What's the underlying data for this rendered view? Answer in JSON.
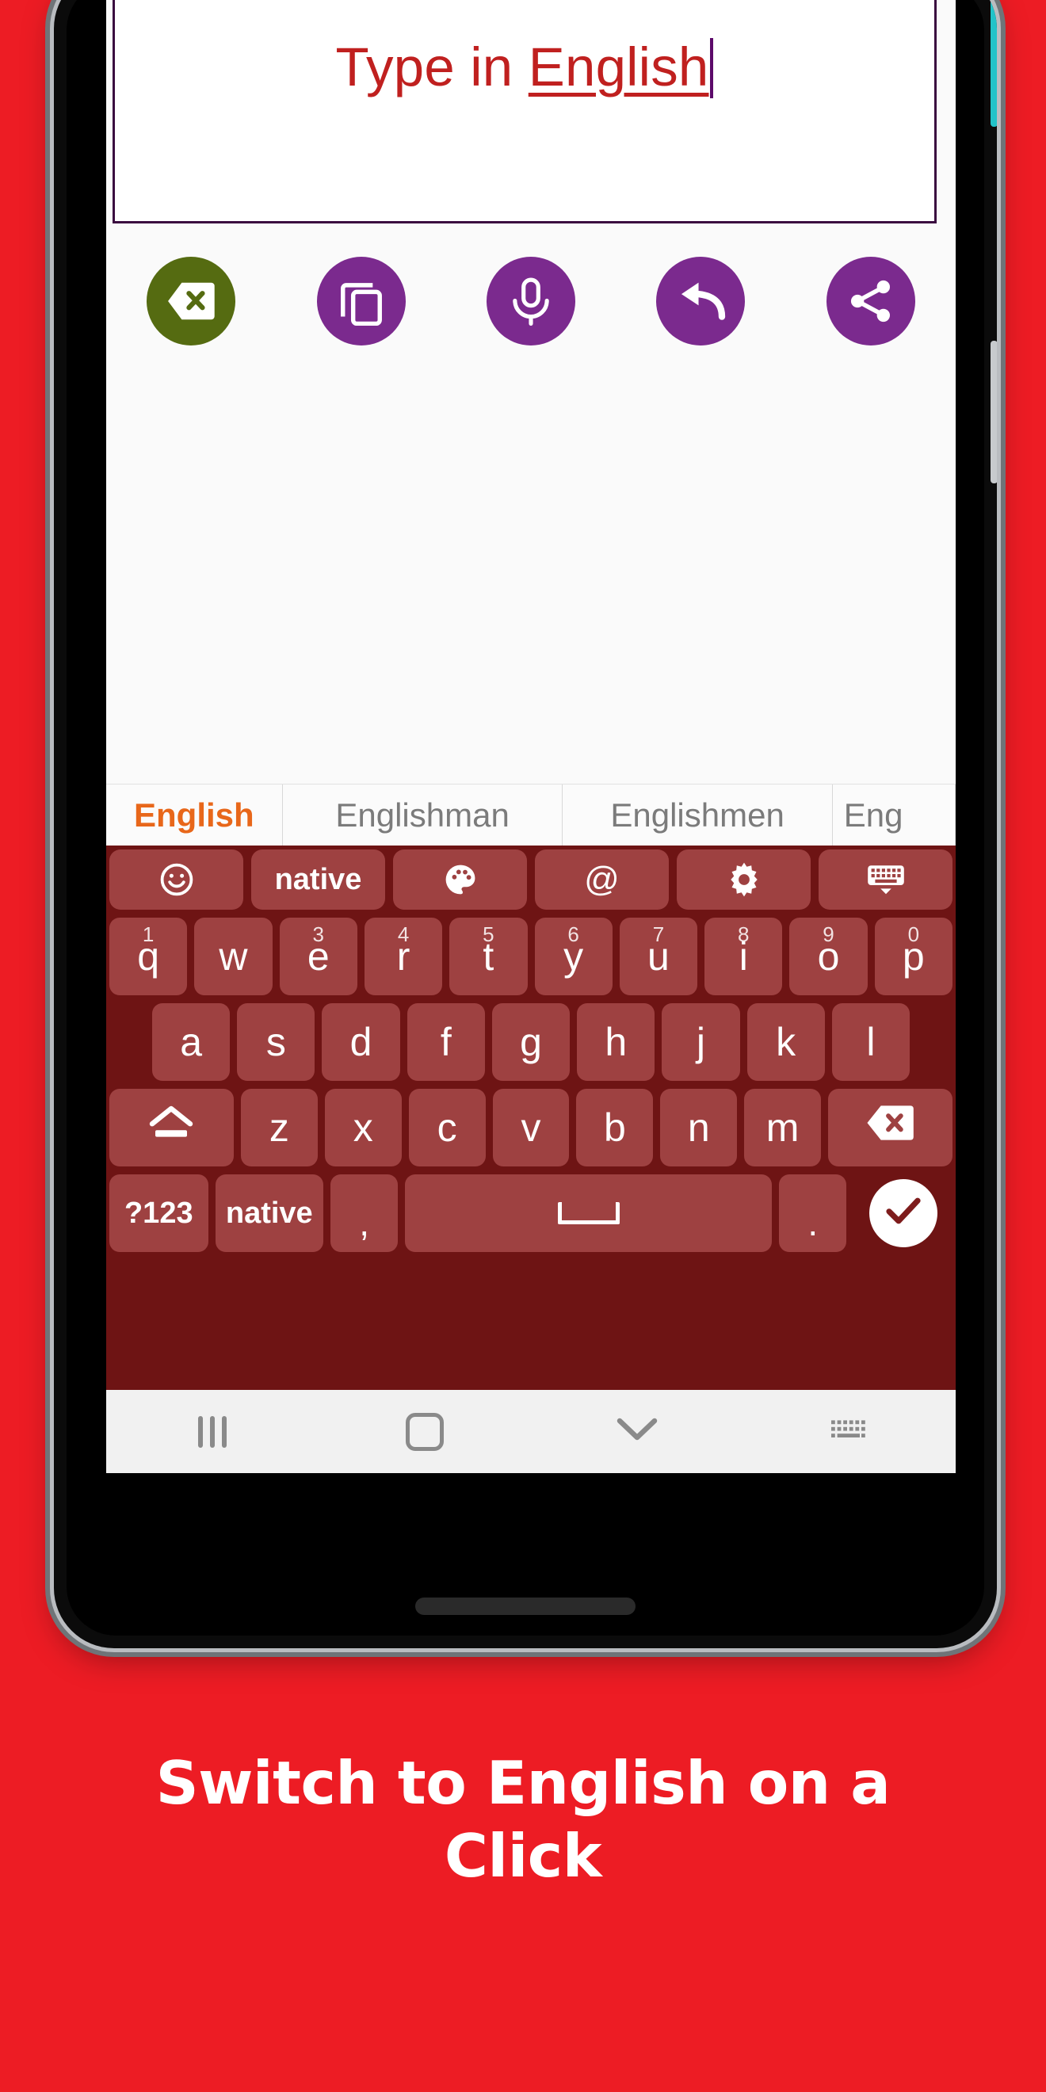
{
  "theme": {
    "page_background": "#ED1C24",
    "accent_purple": "#7B2A8E",
    "accent_green": "#556B11",
    "keyboard_background": "#6E1414",
    "key_background": "#9E4141",
    "suggestion_selected_color": "#E8671A",
    "textfield_text_color": "#C0201F"
  },
  "textfield": {
    "name": "english-input-field",
    "text_prefix": "Type in ",
    "text_underlined": "English",
    "caret_visible": true
  },
  "toolbar": {
    "buttons": [
      {
        "label": "Backspace",
        "icon": "backspace-icon",
        "color": "#556B11"
      },
      {
        "label": "Copy",
        "icon": "copy-icon",
        "color": "#7B2A8E"
      },
      {
        "label": "Voice input",
        "icon": "microphone-icon",
        "color": "#7B2A8E"
      },
      {
        "label": "Undo",
        "icon": "undo-icon",
        "color": "#7B2A8E"
      },
      {
        "label": "Share",
        "icon": "share-icon",
        "color": "#7B2A8E"
      }
    ]
  },
  "suggestions": {
    "items": [
      {
        "text": "English",
        "selected": true
      },
      {
        "text": "Englishman",
        "selected": false
      },
      {
        "text": "Englishmen",
        "selected": false
      },
      {
        "text": "Eng",
        "selected": false
      }
    ]
  },
  "keyboard": {
    "function_row": [
      {
        "label": "",
        "icon": "emoji-icon",
        "name": "emoji-key"
      },
      {
        "label": "native",
        "icon": "",
        "name": "language-native-key"
      },
      {
        "label": "",
        "icon": "palette-icon",
        "name": "theme-palette-key"
      },
      {
        "label": "@",
        "icon": "",
        "name": "at-symbol-key"
      },
      {
        "label": "",
        "icon": "gear-icon",
        "name": "settings-key"
      },
      {
        "label": "",
        "icon": "keyboard-hide-icon",
        "name": "keyboard-hide-key"
      }
    ],
    "row1": [
      {
        "key": "q",
        "num": "1"
      },
      {
        "key": "w",
        "num": ""
      },
      {
        "key": "e",
        "num": "3"
      },
      {
        "key": "r",
        "num": "4"
      },
      {
        "key": "t",
        "num": "5"
      },
      {
        "key": "y",
        "num": "6"
      },
      {
        "key": "u",
        "num": "7"
      },
      {
        "key": "i",
        "num": "8"
      },
      {
        "key": "o",
        "num": "9"
      },
      {
        "key": "p",
        "num": "0"
      }
    ],
    "row2": [
      "a",
      "s",
      "d",
      "f",
      "g",
      "h",
      "j",
      "k",
      "l"
    ],
    "row3": {
      "shift": {
        "label": "",
        "icon": "shift-icon",
        "name": "shift-key"
      },
      "letters": [
        "z",
        "x",
        "c",
        "v",
        "b",
        "n",
        "m"
      ],
      "backspace": {
        "label": "",
        "icon": "backspace-icon",
        "name": "backspace-key"
      }
    },
    "row4": {
      "symbols": "?123",
      "language": "native",
      "comma": ",",
      "space": "",
      "period": ".",
      "enter": ""
    }
  },
  "navbar": {
    "items": [
      {
        "name": "recents-button",
        "icon": "recents-icon"
      },
      {
        "name": "home-button",
        "icon": "home-icon"
      },
      {
        "name": "back-button",
        "icon": "chevron-down-icon"
      },
      {
        "name": "keyboard-switch-button",
        "icon": "keyboard-icon"
      }
    ]
  },
  "caption": {
    "text": "Switch to English on a Click"
  }
}
